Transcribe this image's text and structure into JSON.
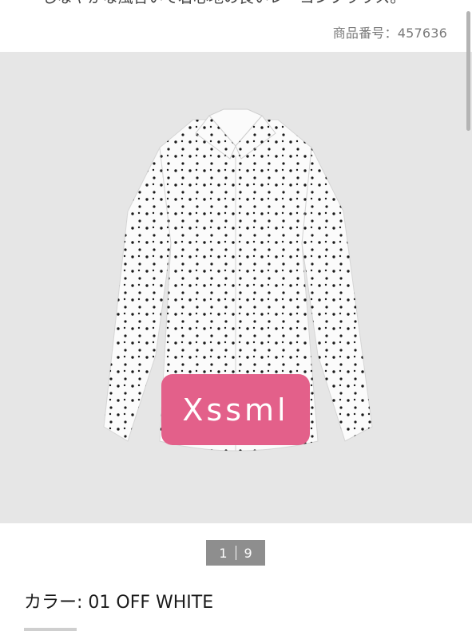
{
  "description": {
    "text": "しなやかな風合いで着心地の良いレーヨンブラウス。"
  },
  "product": {
    "code_label": "商品番号：",
    "code_value": "457636"
  },
  "image": {
    "overlay_text": "Xssml",
    "overlay_color": "#e3608a",
    "background_color": "#e6e6e6",
    "shirt_color": "#fbfbfb",
    "dot_color": "#1a1a1a"
  },
  "pager": {
    "current": "1",
    "total": "9"
  },
  "color": {
    "label": "カラー: ",
    "value": "01 OFF WHITE"
  }
}
